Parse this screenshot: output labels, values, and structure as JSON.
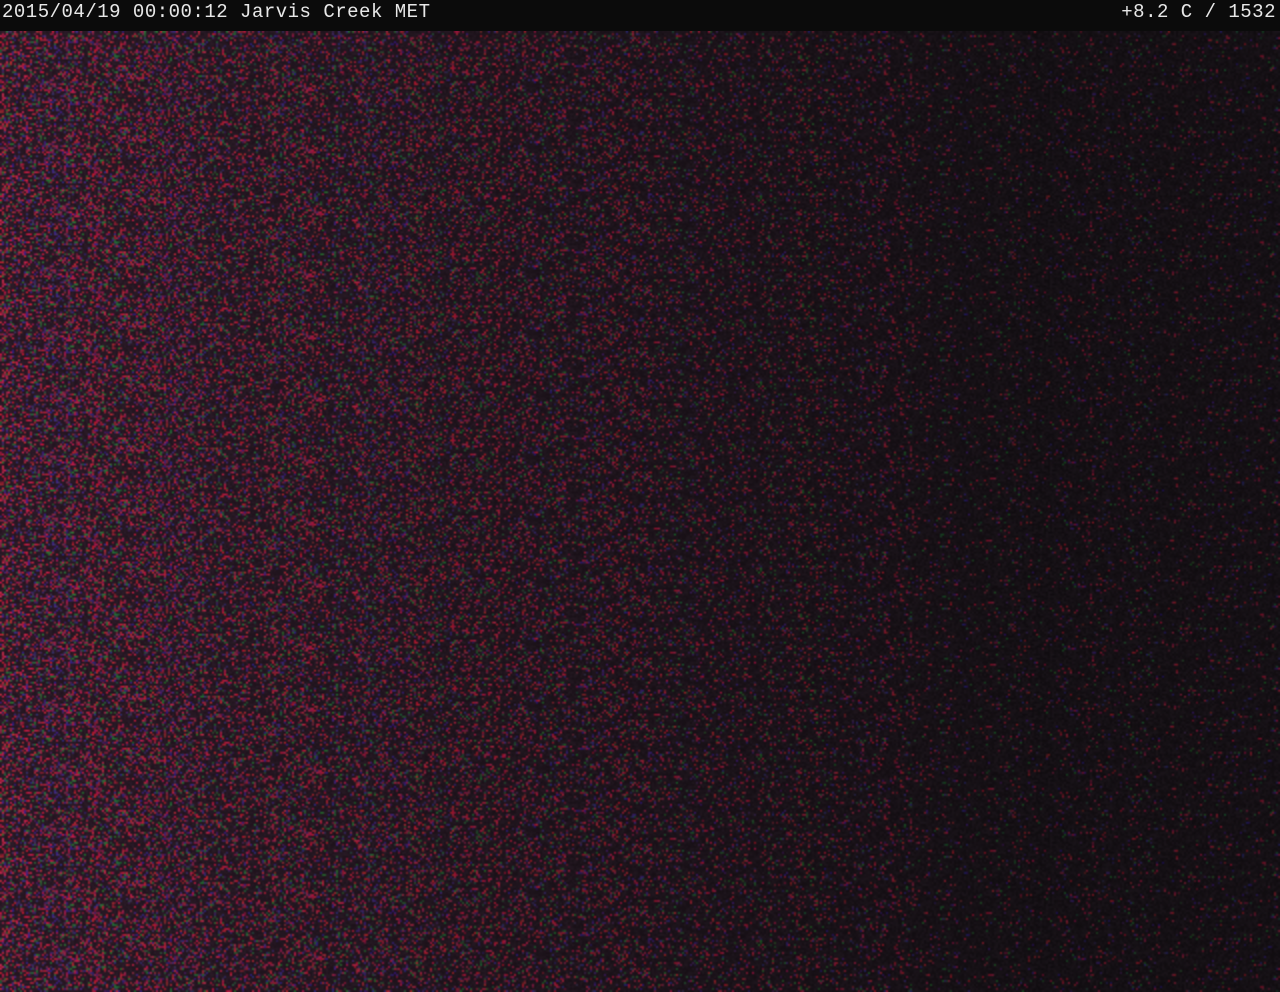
{
  "overlay": {
    "timestamp_station": "2015/04/19 00:00:12 Jarvis Creek MET",
    "temp_elevation": "+8.2 C / 1532"
  },
  "scene": {
    "description_colors": {
      "base": "#111111",
      "noise_red": "#b0203a",
      "noise_blue": "#3a2a7a",
      "noise_green": "#2a6a3a"
    }
  }
}
